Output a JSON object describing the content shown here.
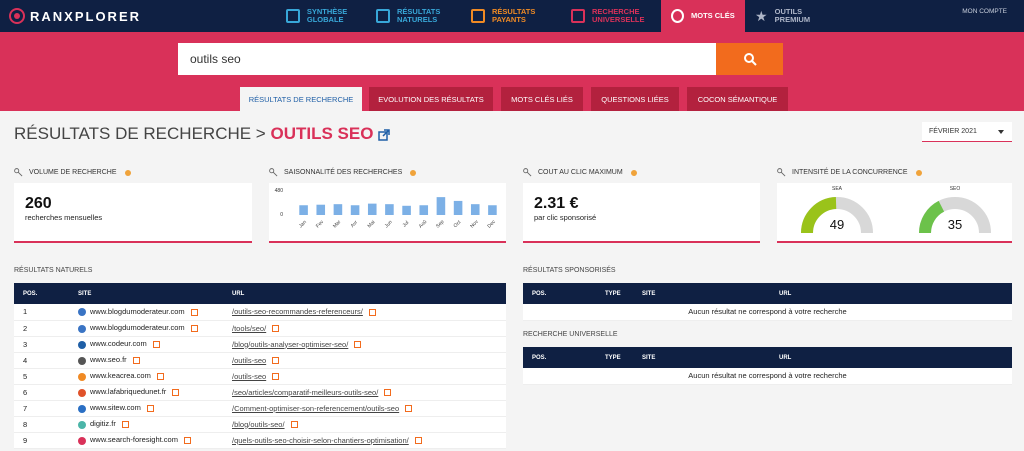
{
  "brand": "RANXPLORER",
  "nav": [
    {
      "label": "SYNTHÈSE GLOBALE",
      "color": "#38a7d8"
    },
    {
      "label": "RÉSULTATS NATURELS",
      "color": "#38a7d8"
    },
    {
      "label": "RÉSULTATS PAYANTS",
      "color": "#f08a24"
    },
    {
      "label": "RECHERCHE UNIVERSELLE",
      "color": "#d93159"
    },
    {
      "label": "MOTS CLÉS",
      "color": "#ffffff"
    },
    {
      "label": "OUTILS PREMIUM",
      "color": "#aeb6c8"
    }
  ],
  "account": "MON COMPTE",
  "search": {
    "value": "outils seo"
  },
  "tabs": [
    {
      "label": "RÉSULTATS DE RECHERCHE"
    },
    {
      "label": "EVOLUTION DES RÉSULTATS"
    },
    {
      "label": "MOTS CLÉS LIÉS"
    },
    {
      "label": "QUESTIONS LIÉES"
    },
    {
      "label": "COCON SÉMANTIQUE"
    }
  ],
  "title": {
    "prefix": "RÉSULTATS DE RECHERCHE >",
    "keyword": "OUTILS SEO"
  },
  "date": "FÉVRIER 2021",
  "cards": {
    "volume": {
      "head": "VOLUME DE RECHERCHE",
      "value": "260",
      "label": "recherches mensuelles"
    },
    "saison": {
      "head": "SAISONNALITÉ DES RECHERCHES"
    },
    "cpc": {
      "head": "COUT AU CLIC MAXIMUM",
      "value": "2.31 €",
      "label": "par clic sponsorisé"
    },
    "concurrence": {
      "head": "INTENSITÉ DE LA CONCURRENCE",
      "sea_label": "SEA",
      "seo_label": "SEO",
      "sea": "49",
      "seo": "35",
      "sea_num": 49,
      "seo_num": 35
    }
  },
  "chart_data": {
    "type": "bar",
    "categories": [
      "Jan",
      "Fev",
      "Mar",
      "Avr",
      "Mai",
      "Jun",
      "Jul",
      "Aoû",
      "Sep",
      "Oct",
      "Nov",
      "Dec"
    ],
    "values": [
      180,
      190,
      200,
      180,
      210,
      200,
      170,
      180,
      330,
      260,
      200,
      180
    ],
    "yticks": [
      "480",
      "0"
    ],
    "ylim": [
      0,
      480
    ]
  },
  "naturels": {
    "label": "RÉSULTATS NATURELS",
    "headers": [
      "POS.",
      "SITE",
      "URL"
    ],
    "rows": [
      {
        "pos": "1",
        "site": "www.blogdumoderateur.com",
        "url": "/outils-seo-recommandes-referenceurs/",
        "color": "#3a74c4"
      },
      {
        "pos": "2",
        "site": "www.blogdumoderateur.com",
        "url": "/tools/seo/",
        "color": "#3a74c4"
      },
      {
        "pos": "3",
        "site": "www.codeur.com",
        "url": "/blog/outils-analyser-optimiser-seo/",
        "color": "#1f5fa6"
      },
      {
        "pos": "4",
        "site": "www.seo.fr",
        "url": "/outils-seo",
        "color": "#555555"
      },
      {
        "pos": "5",
        "site": "www.keacrea.com",
        "url": "/outils-seo",
        "color": "#f08a24"
      },
      {
        "pos": "6",
        "site": "www.lafabriquedunet.fr",
        "url": "/seo/articles/comparatif-meilleurs-outils-seo/",
        "color": "#e0522a"
      },
      {
        "pos": "7",
        "site": "www.sitew.com",
        "url": "/Comment-optimiser-son-referencement/outils-seo",
        "color": "#2a6fc4"
      },
      {
        "pos": "8",
        "site": "digitiz.fr",
        "url": "/blog/outils-seo/",
        "color": "#4bb5a8"
      },
      {
        "pos": "9",
        "site": "www.search-foresight.com",
        "url": "/quels-outils-seo-choisir-selon-chantiers-optimisation/",
        "color": "#d93159"
      }
    ]
  },
  "sponsorises": {
    "label": "RÉSULTATS SPONSORISÉS",
    "headers": [
      "POS.",
      "TYPE",
      "SITE",
      "URL"
    ],
    "empty": "Aucun résultat ne correspond à votre recherche"
  },
  "universelle": {
    "label": "RECHERCHE UNIVERSELLE",
    "headers": [
      "POS.",
      "TYPE",
      "SITE",
      "URL"
    ],
    "empty": "Aucun résultat ne correspond à votre recherche"
  }
}
